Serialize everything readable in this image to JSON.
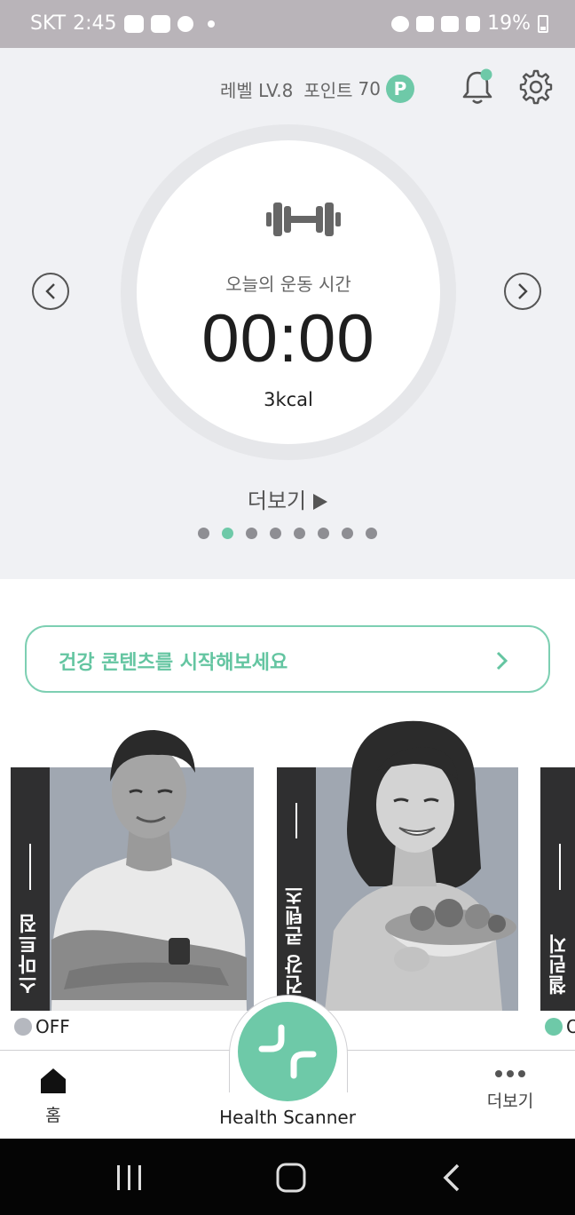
{
  "status_bar": {
    "carrier": "SKT",
    "time": "2:45",
    "battery": "19%"
  },
  "header": {
    "level_label": "레벨",
    "level_value": "LV.8",
    "points_label": "포인트",
    "points_value": "70",
    "points_badge": "P"
  },
  "workout": {
    "label": "오늘의 운동 시간",
    "timer": "00:00",
    "calories": "3kcal",
    "more_label": "더보기",
    "pager_count": 8,
    "pager_active_index": 1
  },
  "banner": {
    "text": "건강 콘텐츠를 시작해보세요"
  },
  "cards": [
    {
      "label": "스마트짐",
      "status": "OFF"
    },
    {
      "label": "건강 콘텐츠",
      "status": ""
    },
    {
      "label": "챌린지",
      "status": "O"
    }
  ],
  "bottom_nav": {
    "home_label": "홈",
    "scanner_label": "Health Scanner",
    "more_label": "더보기"
  },
  "colors": {
    "accent": "#6ec9a8",
    "panel_bg": "#f0f1f4",
    "status_bar": "#b9b4b9"
  }
}
